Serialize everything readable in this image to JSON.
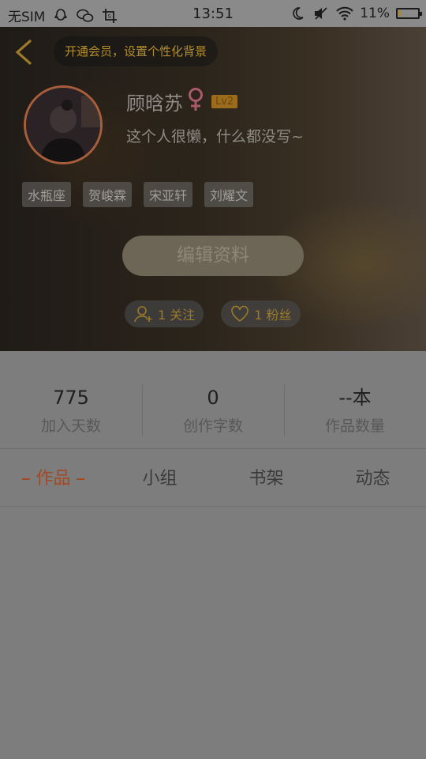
{
  "status_bar": {
    "carrier": "无SIM",
    "time": "13:51",
    "battery_text": "11%",
    "battery_level": 0.11,
    "icons": [
      "qq-icon",
      "wechat-icon",
      "screenshot-icon",
      "moon-icon",
      "mute-icon",
      "wifi-icon",
      "battery-icon"
    ]
  },
  "header": {
    "vip_prompt": "开通会员，设置个性化背景",
    "user": {
      "name": "顾晗苏",
      "gender_symbol": "♀",
      "level": "Lv2",
      "bio": "这个人很懒，什么都没写~"
    },
    "tags": [
      "水瓶座",
      "贺峻霖",
      "宋亚轩",
      "刘耀文"
    ],
    "edit_button": "编辑资料",
    "following": "1 关注",
    "followers": "1 粉丝"
  },
  "stats": [
    {
      "value": "775",
      "label": "加入天数"
    },
    {
      "value": "0",
      "label": "创作字数"
    },
    {
      "value": "--本",
      "label": "作品数量"
    }
  ],
  "tabs": [
    {
      "label": "作品",
      "active": true
    },
    {
      "label": "小组",
      "active": false
    },
    {
      "label": "书架",
      "active": false
    },
    {
      "label": "动态",
      "active": false
    }
  ],
  "colors": {
    "accent": "#a04a26",
    "gold": "#b58e2c",
    "gender": "#a85a6a",
    "overlay_gray": "#7d7d7d"
  }
}
